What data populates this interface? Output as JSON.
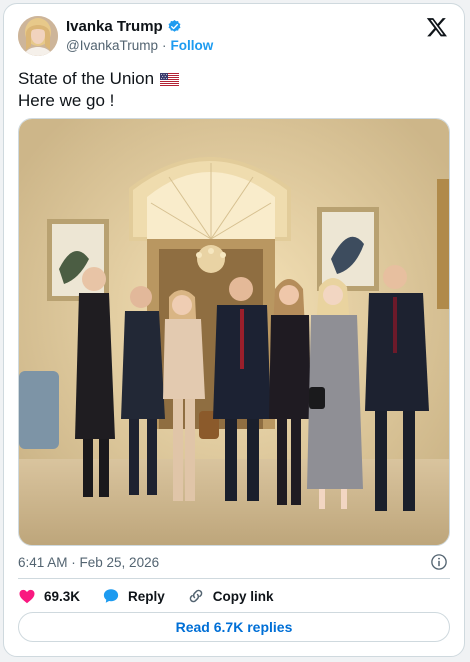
{
  "author": {
    "name": "Ivanka Trump",
    "handle": "@IvankaTrump",
    "separator": "·",
    "follow_label": "Follow"
  },
  "tweet": {
    "line1": "State of the Union",
    "line2": "Here we go !",
    "timestamp": "6:41 AM · Feb 25, 2026"
  },
  "actions": {
    "like_count": "69.3K",
    "reply_label": "Reply",
    "copy_label": "Copy link"
  },
  "read_replies_label": "Read 6.7K replies",
  "icons": [
    "verified-badge-icon",
    "x-logo-icon",
    "us-flag-icon",
    "info-icon",
    "heart-icon",
    "reply-bubble-icon",
    "link-icon"
  ],
  "colors": {
    "accent": "#1d9bf0",
    "like": "#f91880",
    "link_text": "#006fd6",
    "muted": "#536471"
  }
}
